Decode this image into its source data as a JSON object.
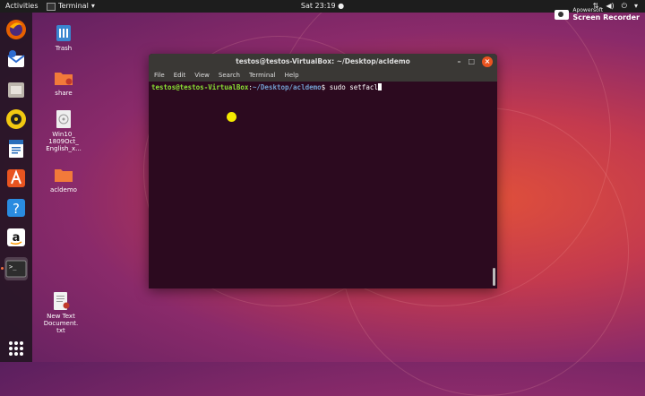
{
  "topbar": {
    "activities": "Activities",
    "app_menu": "Terminal",
    "clock": "Sat 23:19 ●"
  },
  "recorder": {
    "brand": "Apowersoft",
    "name": "Screen Recorder"
  },
  "dock": {
    "items": [
      "firefox-icon",
      "thunderbird-icon",
      "files-icon",
      "rhythmbox-icon",
      "writer-icon",
      "software-center-icon",
      "help-icon",
      "amazon-icon",
      "terminal-icon"
    ],
    "show_apps": "apps-grid-icon"
  },
  "desktop": {
    "icons": [
      {
        "label": "Trash"
      },
      {
        "label": "share"
      },
      {
        "label": "Win10_\n1809Oct_\nEnglish_x..."
      },
      {
        "label": "acldemo"
      },
      {
        "label": "New Text\nDocument.\ntxt"
      }
    ]
  },
  "terminal": {
    "title": "testos@testos-VirtualBox: ~/Desktop/acldemo",
    "menu": [
      "File",
      "Edit",
      "View",
      "Search",
      "Terminal",
      "Help"
    ],
    "prompt_user": "testos@testos-VirtualBox",
    "prompt_sep": ":",
    "prompt_path": "~/Desktop/acldemo",
    "prompt_dollar": "$ ",
    "command": "sudo setfacl",
    "buttons": {
      "minimize": "–",
      "maximize": "□",
      "close": "×"
    }
  },
  "colors": {
    "accent": "#e95420",
    "terminal_bg": "#2c0a1f",
    "prompt_user": "#8ae234",
    "prompt_path": "#729fcf"
  }
}
